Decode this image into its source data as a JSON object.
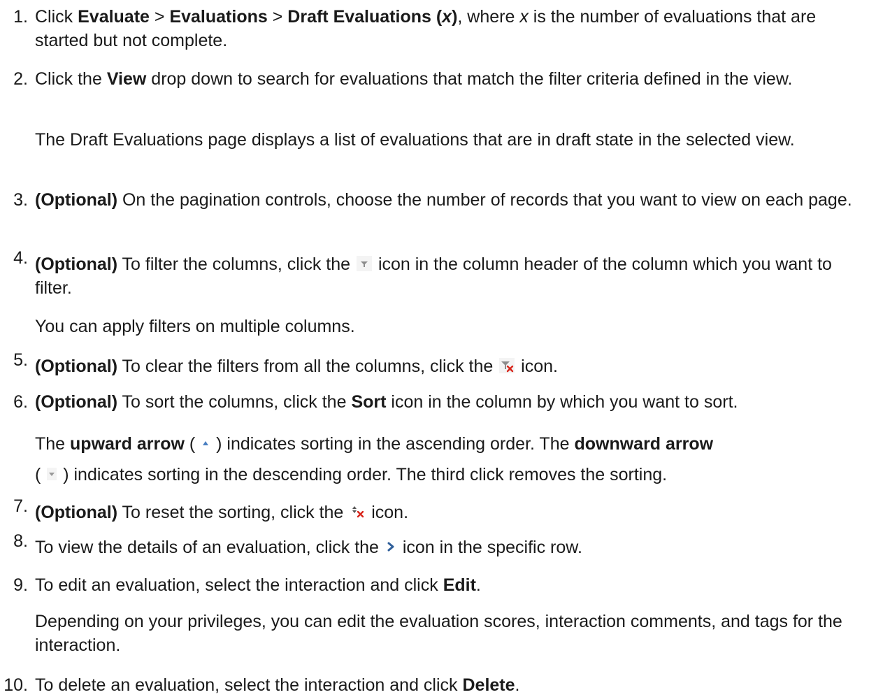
{
  "steps": [
    {
      "number": "1.",
      "parts": [
        {
          "t": "Click ",
          "b": false
        },
        {
          "t": "Evaluate",
          "b": true
        },
        {
          "t": " > ",
          "b": false
        },
        {
          "t": "Evaluations",
          "b": true
        },
        {
          "t": " > ",
          "b": false
        },
        {
          "t": "Draft Evaluations (",
          "b": true
        },
        {
          "t": "x",
          "b": true,
          "i": true
        },
        {
          "t": ")",
          "b": true
        },
        {
          "t": ", where ",
          "b": false
        },
        {
          "t": "x",
          "b": false,
          "i": true
        },
        {
          "t": " is the number of evaluations that are started but not complete.",
          "b": false
        }
      ]
    },
    {
      "number": "2.",
      "parts": [
        {
          "t": "Click the ",
          "b": false
        },
        {
          "t": "View",
          "b": true
        },
        {
          "t": " drop down to search for evaluations that match the filter criteria defined in the view.",
          "b": false
        }
      ],
      "note": "The Draft Evaluations page displays a list of evaluations that are in draft state in the selected view."
    },
    {
      "number": "3.",
      "optional": "(Optional)",
      "text": " On the pagination controls, choose the number of records that you want to view on each page."
    },
    {
      "number": "4.",
      "optional": "(Optional)",
      "before_icon": " To filter the columns, click the ",
      "icon": "filter-icon",
      "after_icon": " icon in the column header of the column which you want to filter.",
      "note": "You can apply filters on multiple columns."
    },
    {
      "number": "5.",
      "optional": "(Optional)",
      "before_icon": " To clear the filters from all the columns, click the ",
      "icon": "clear-filter-icon",
      "after_icon": " icon."
    },
    {
      "number": "6.",
      "optional": "(Optional)",
      "parts": [
        {
          "t": " To sort the columns, click the ",
          "b": false
        },
        {
          "t": "Sort",
          "b": true
        },
        {
          "t": " icon in the column by which you want to sort.",
          "b": false
        }
      ],
      "note_parts": {
        "a": "The ",
        "b": "upward arrow",
        "c": " ( ",
        "d": " ) indicates sorting in the ascending order. The ",
        "e": "downward arrow",
        "f": "( ",
        "g": " ) indicates sorting in the descending order. The third click removes the sorting."
      }
    },
    {
      "number": "7.",
      "optional": "(Optional)",
      "before_icon": " To reset the sorting, click the ",
      "icon": "reset-sort-icon",
      "after_icon": " icon."
    },
    {
      "number": "8.",
      "before_icon": "To view the details of an evaluation, click the ",
      "icon": "expand-chevron-icon",
      "after_icon": " icon in the specific row."
    },
    {
      "number": "9.",
      "parts": [
        {
          "t": "To edit an evaluation, select the interaction and click ",
          "b": false
        },
        {
          "t": "Edit",
          "b": true
        },
        {
          "t": ".",
          "b": false
        }
      ],
      "note": "Depending on your privileges, you can edit the evaluation scores, interaction comments, and tags for the interaction."
    },
    {
      "number": "10.",
      "parts": [
        {
          "t": "To delete an evaluation, select the interaction and click ",
          "b": false
        },
        {
          "t": "Delete",
          "b": true
        },
        {
          "t": ".",
          "b": false
        }
      ]
    }
  ],
  "colors": {
    "text": "#1a1a1a",
    "icon_grey": "#9a9a9a",
    "icon_blue": "#4a7fc1",
    "icon_red": "#d9261c",
    "chevron": "#2f5f9a"
  }
}
